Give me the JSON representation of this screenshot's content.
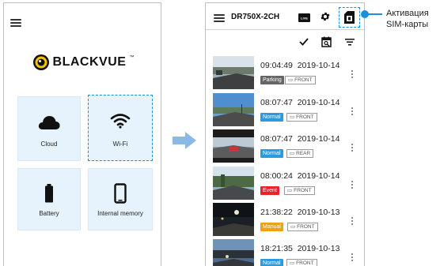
{
  "left_screen": {
    "brand": "BLACKVUE",
    "tiles": [
      {
        "label": "Cloud",
        "icon": "cloud-icon"
      },
      {
        "label": "Wi-Fi",
        "icon": "wifi-icon"
      },
      {
        "label": "Battery",
        "icon": "battery-icon"
      },
      {
        "label": "Internal memory",
        "icon": "phone-memory-icon"
      }
    ]
  },
  "right_screen": {
    "title": "DR750X-2CH",
    "live_badge": "LIVE",
    "icons": [
      "menu-icon",
      "live-icon",
      "gear-icon",
      "sim-card-icon",
      "check-icon",
      "calendar-search-icon",
      "filter-icon"
    ],
    "recordings": [
      {
        "time": "09:04:49",
        "date": "2019-10-14",
        "type": "Parking",
        "type_color": "#666666",
        "camera": "FRONT",
        "thumb": "day-road"
      },
      {
        "time": "08:07:47",
        "date": "2019-10-14",
        "type": "Normal",
        "type_color": "#2a9be0",
        "camera": "FRONT",
        "thumb": "day-sky"
      },
      {
        "time": "08:07:47",
        "date": "2019-10-14",
        "type": "Normal",
        "type_color": "#2a9be0",
        "camera": "REAR",
        "thumb": "rear"
      },
      {
        "time": "08:00:24",
        "date": "2019-10-14",
        "type": "Event",
        "type_color": "#e8232a",
        "camera": "FRONT",
        "thumb": "day-trees"
      },
      {
        "time": "21:38:22",
        "date": "2019-10-13",
        "type": "Manual",
        "type_color": "#f0a10c",
        "camera": "FRONT",
        "thumb": "night"
      },
      {
        "time": "18:21:35",
        "date": "2019-10-13",
        "type": "Normal",
        "type_color": "#2a9be0",
        "camera": "FRONT",
        "thumb": "dusk"
      }
    ]
  },
  "annotation": {
    "line1": "Активация",
    "line2": "SIM-карты"
  },
  "colors": {
    "accent": "#1e8ed8",
    "tile_bg": "#e6f3fc",
    "arrow": "#8ab9e6"
  }
}
